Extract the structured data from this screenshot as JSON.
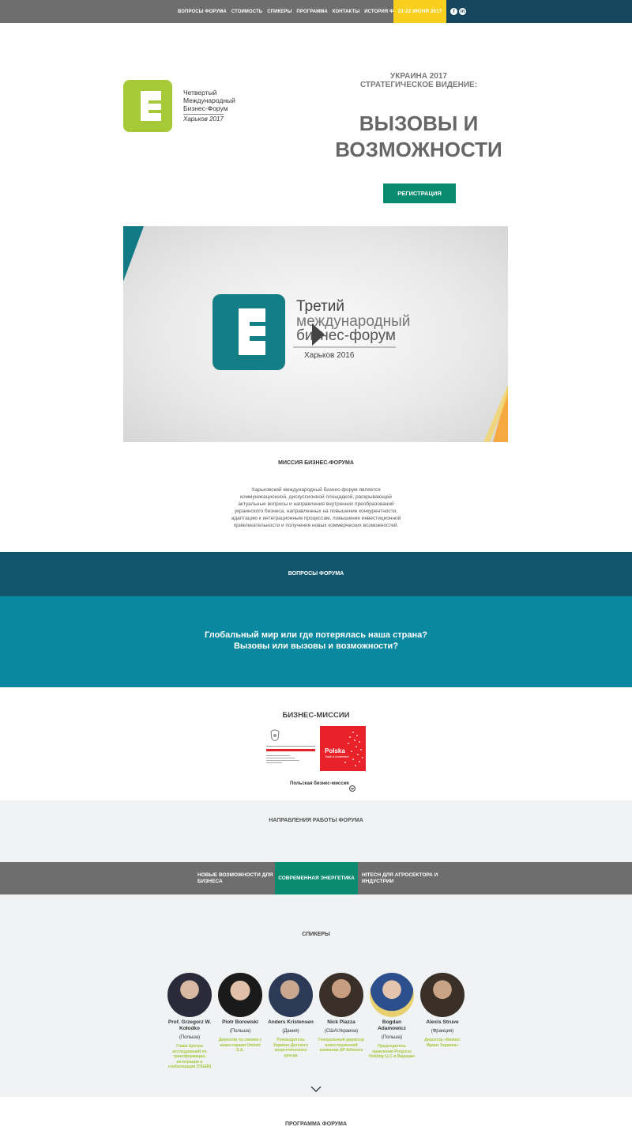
{
  "nav": {
    "links": [
      "ВОПРОСЫ ФОРУМА",
      "СТОИМОСТЬ",
      "СПИКЕРЫ",
      "ПРОГРАММА",
      "КОНТАКТЫ",
      "ИСТОРИЯ ФОРУМА"
    ],
    "date": "21-22 ИЮНЯ 2017",
    "social": [
      "f",
      "in"
    ]
  },
  "logo": {
    "line1": "Четвертый",
    "line2": "Международный",
    "line3": "Бизнес-Форум",
    "year": "Харьков 2017"
  },
  "hero": {
    "sub1": "УКРАИНА 2017",
    "sub2": "СТРАТЕГИЧЕСКОЕ ВИДЕНИЕ:",
    "big1": "ВЫЗОВЫ И",
    "big2": "ВОЗМОЖНОСТИ",
    "register": "РЕГИСТРАЦИЯ"
  },
  "video": {
    "line1": "Третий",
    "line2": "международный",
    "line3": "бизнес-форум",
    "city": "Харьков 2016"
  },
  "mission": {
    "title": "МИССИЯ БИЗНЕС-ФОРУМА",
    "lines": [
      "Харьковский международный бизнес-форум является",
      "коммуникационной, дискуссионной площадкой, раскрывающей",
      "актуальные вопросы и направления внутренних преобразований",
      "украинского бизнеса, направленных на повышение конкурентности,",
      "адаптацию к интеграционным процессам, повышение инвестиционной",
      "привлекательности и получения новых коммерческих возможностей."
    ]
  },
  "questions": {
    "title": "ВОПРОСЫ ФОРУМА",
    "line1": "Глобальный мир или где потерялась наша страна?",
    "line2": "Вызовы или вызовы и возможности?"
  },
  "missions": {
    "title": "БИЗНЕС-МИССИИ",
    "polish": "Польская бизнес-миссия",
    "polska": "Polska",
    "polska_sub": "Trade & Investment"
  },
  "directions": {
    "title": "НАПРАВЛЕНИЯ РАБОТЫ ФОРУМА",
    "tabs": [
      {
        "l1": "НОВЫЕ ВОЗМОЖНОСТИ ДЛЯ",
        "l2": "БИЗНЕСА"
      },
      {
        "l1": "СОВРЕМЕННАЯ ЭНЕРГЕТИКА",
        "l2": ""
      },
      {
        "l1": "HITECH ДЛЯ АГРОСЕКТОРА И",
        "l2": "ИНДУСТРИИ"
      }
    ]
  },
  "speakers": {
    "title": "СПИКЕРЫ",
    "list": [
      {
        "name1": "Prof. Grzegorz W.",
        "name2": "Kołodko",
        "country": "(Польша)",
        "role": [
          "Глава Центра",
          "исследований по",
          "трансформации,",
          "интеграции и",
          "глобализации (TIGER)"
        ]
      },
      {
        "name1": "Piotr Borowski",
        "name2": "",
        "country": "(Польша)",
        "role": [
          "Директор по связям с",
          "инвесторами Unimot",
          "S.A."
        ]
      },
      {
        "name1": "Anders Kristensen",
        "name2": "",
        "country": "(Дания)",
        "role": [
          "Руководитель",
          "Украино-Датского",
          "энергетического",
          "центра"
        ]
      },
      {
        "name1": "Nick Piazza",
        "name2": "",
        "country": "(США\\Украина)",
        "role": [
          "Генеральный директор",
          "инвестиционной",
          "компании SP Advisors"
        ]
      },
      {
        "name1": "Bogdan",
        "name2": "Adamowicz",
        "country": "(Польша)",
        "role": [
          "Председатель",
          "правления Progress",
          "Holding LLC в Варшаве"
        ]
      },
      {
        "name1": "Alexis Struve",
        "name2": "",
        "country": "(Франция)",
        "role": [
          "Директор «Бизнес",
          "Франс Украина»"
        ]
      }
    ]
  },
  "program": {
    "title": "ПРОГРАММА ФОРУМА"
  },
  "colors": {
    "accent_green": "#0a8a6e",
    "yellow": "#f7cf1c",
    "navy": "#17465f",
    "teal": "#0a88a0",
    "lime": "#a3c93a"
  }
}
